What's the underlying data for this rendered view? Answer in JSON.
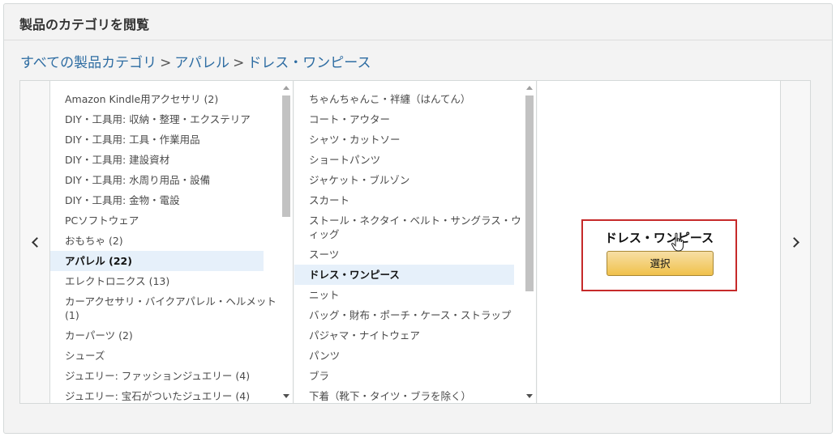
{
  "header": {
    "title": "製品のカテゴリを閲覧"
  },
  "breadcrumb": {
    "items": [
      "すべての製品カテゴリ",
      "アパレル",
      "ドレス・ワンピース"
    ],
    "separator": ">"
  },
  "column1": {
    "items": [
      "Amazon Kindle用アクセサリ (2)",
      "DIY・工具用: 収納・整理・エクステリア",
      "DIY・工具用: 工具・作業用品",
      "DIY・工具用: 建設資材",
      "DIY・工具用: 水周り用品・設備",
      "DIY・工具用: 金物・電設",
      "PCソフトウェア",
      "おもちゃ (2)",
      "アパレル (22)",
      "エレクトロニクス (13)",
      "カーアクセサリ・バイクアパレル・ヘルメット (1)",
      "カーパーツ (2)",
      "シューズ",
      "ジュエリー: ファッションジュエリー (4)",
      "ジュエリー: 宝石がついたジュエリー (4)"
    ],
    "selected": "アパレル (22)"
  },
  "column2": {
    "items": [
      "ちゃんちゃんこ・袢纏（はんてん）",
      "コート・アウター",
      "シャツ・カットソー",
      "ショートパンツ",
      "ジャケット・ブルゾン",
      "スカート",
      "ストール・ネクタイ・ベルト・サングラス・ウィッグ",
      "スーツ",
      "ドレス・ワンピース",
      "ニット",
      "バッグ・財布・ポーチ・ケース・ストラップ",
      "パジャマ・ナイトウェア",
      "パンツ",
      "ブラ",
      "下着（靴下・タイツ・ブラを除く）"
    ],
    "selected": "ドレス・ワンピース"
  },
  "selection": {
    "title": "ドレス・ワンピース",
    "button_label": "選択"
  },
  "icons": {
    "nav_left": "chevron-left-icon",
    "nav_right": "chevron-right-icon",
    "cursor": "hand-pointer-icon"
  }
}
